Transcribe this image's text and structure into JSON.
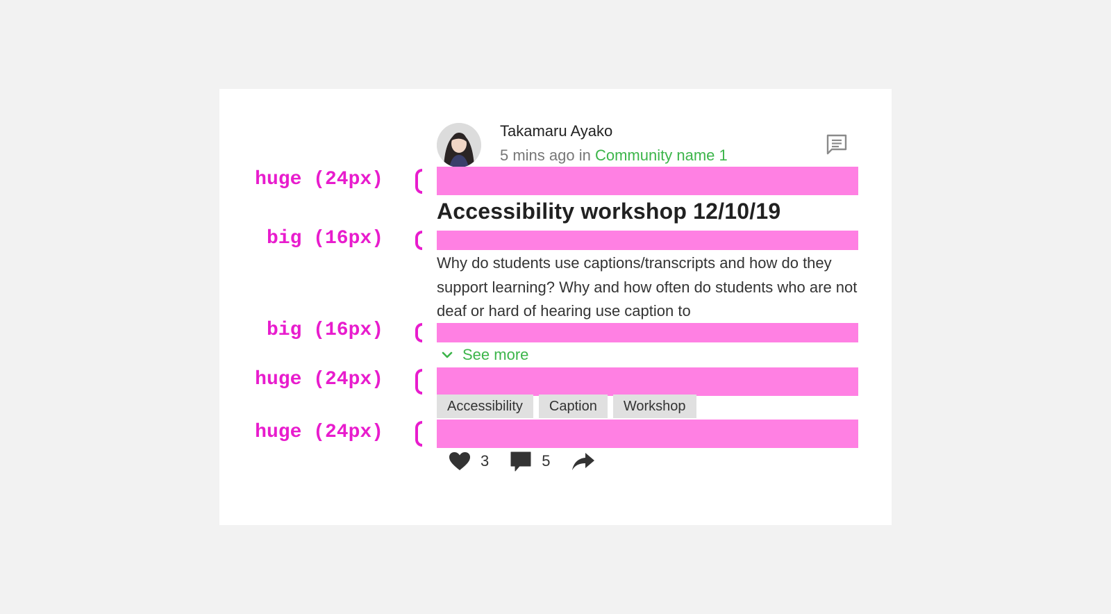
{
  "post": {
    "author": "Takamaru Ayako",
    "time": "5 mins ago in",
    "community": "Community name 1",
    "title": "Accessibility workshop 12/10/19",
    "body": "Why do students use captions/transcripts and how do they support learning? Why and how often do students who are not deaf or hard of hearing use caption to",
    "see_more": "See more",
    "tags": [
      "Accessibility",
      "Caption",
      "Workshop"
    ],
    "likes": "3",
    "comments": "5"
  },
  "spacing": {
    "huge": "huge (24px)",
    "big": "big (16px)"
  },
  "icons": {
    "comment": "comment-icon",
    "chevron": "chevron-down-icon",
    "heart": "heart-icon",
    "chat": "chat-bubble-icon",
    "share": "share-icon"
  },
  "colors": {
    "accent": "#3cb54a",
    "spacing_band": "#ff80e3",
    "annotation": "#e81ccd",
    "tag_bg": "#e0e0e0"
  }
}
